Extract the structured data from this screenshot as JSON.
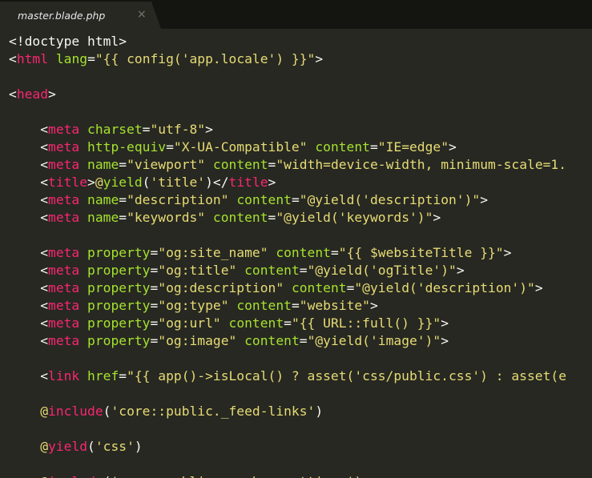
{
  "tab": {
    "title": "master.blade.php",
    "close_glyph": "×"
  },
  "theme": {
    "background": "#272822",
    "tabbar": "#141411",
    "plain": "#f8f8f2",
    "tag": "#f92672",
    "attribute": "#a6e22e",
    "string": "#e6db74"
  },
  "code": {
    "lines": [
      [
        [
          "p",
          "<!doctype html>"
        ]
      ],
      [
        [
          "p",
          "<"
        ],
        [
          "t",
          "html"
        ],
        [
          "p",
          " "
        ],
        [
          "a",
          "lang"
        ],
        [
          "p",
          "="
        ],
        [
          "s",
          "\"{{ config('app.locale') }}\""
        ],
        [
          "p",
          ">"
        ]
      ],
      [],
      [
        [
          "p",
          "<"
        ],
        [
          "t",
          "head"
        ],
        [
          "p",
          ">"
        ]
      ],
      [],
      [
        [
          "p",
          "    <"
        ],
        [
          "t",
          "meta"
        ],
        [
          "p",
          " "
        ],
        [
          "a",
          "charset"
        ],
        [
          "p",
          "="
        ],
        [
          "s",
          "\"utf-8\""
        ],
        [
          "p",
          ">"
        ]
      ],
      [
        [
          "p",
          "    <"
        ],
        [
          "t",
          "meta"
        ],
        [
          "p",
          " "
        ],
        [
          "a",
          "http-equiv"
        ],
        [
          "p",
          "="
        ],
        [
          "s",
          "\"X-UA-Compatible\""
        ],
        [
          "p",
          " "
        ],
        [
          "a",
          "content"
        ],
        [
          "p",
          "="
        ],
        [
          "s",
          "\"IE=edge\""
        ],
        [
          "p",
          ">"
        ]
      ],
      [
        [
          "p",
          "    <"
        ],
        [
          "t",
          "meta"
        ],
        [
          "p",
          " "
        ],
        [
          "a",
          "name"
        ],
        [
          "p",
          "="
        ],
        [
          "s",
          "\"viewport\""
        ],
        [
          "p",
          " "
        ],
        [
          "a",
          "content"
        ],
        [
          "p",
          "="
        ],
        [
          "s",
          "\"width=device-width, minimum-scale=1."
        ]
      ],
      [
        [
          "p",
          "    <"
        ],
        [
          "t",
          "title"
        ],
        [
          "p",
          ">"
        ],
        [
          "s",
          "@"
        ],
        [
          "a",
          "yield"
        ],
        [
          "p",
          "("
        ],
        [
          "s",
          "'title'"
        ],
        [
          "p",
          ")</"
        ],
        [
          "t",
          "title"
        ],
        [
          "p",
          ">"
        ]
      ],
      [
        [
          "p",
          "    <"
        ],
        [
          "t",
          "meta"
        ],
        [
          "p",
          " "
        ],
        [
          "a",
          "name"
        ],
        [
          "p",
          "="
        ],
        [
          "s",
          "\"description\""
        ],
        [
          "p",
          " "
        ],
        [
          "a",
          "content"
        ],
        [
          "p",
          "="
        ],
        [
          "s",
          "\"@yield('description')\""
        ],
        [
          "p",
          ">"
        ]
      ],
      [
        [
          "p",
          "    <"
        ],
        [
          "t",
          "meta"
        ],
        [
          "p",
          " "
        ],
        [
          "a",
          "name"
        ],
        [
          "p",
          "="
        ],
        [
          "s",
          "\"keywords\""
        ],
        [
          "p",
          " "
        ],
        [
          "a",
          "content"
        ],
        [
          "p",
          "="
        ],
        [
          "s",
          "\"@yield('keywords')\""
        ],
        [
          "p",
          ">"
        ]
      ],
      [],
      [
        [
          "p",
          "    <"
        ],
        [
          "t",
          "meta"
        ],
        [
          "p",
          " "
        ],
        [
          "a",
          "property"
        ],
        [
          "p",
          "="
        ],
        [
          "s",
          "\"og:site_name\""
        ],
        [
          "p",
          " "
        ],
        [
          "a",
          "content"
        ],
        [
          "p",
          "="
        ],
        [
          "s",
          "\"{{ $websiteTitle }}\""
        ],
        [
          "p",
          ">"
        ]
      ],
      [
        [
          "p",
          "    <"
        ],
        [
          "t",
          "meta"
        ],
        [
          "p",
          " "
        ],
        [
          "a",
          "property"
        ],
        [
          "p",
          "="
        ],
        [
          "s",
          "\"og:title\""
        ],
        [
          "p",
          " "
        ],
        [
          "a",
          "content"
        ],
        [
          "p",
          "="
        ],
        [
          "s",
          "\"@yield('ogTitle')\""
        ],
        [
          "p",
          ">"
        ]
      ],
      [
        [
          "p",
          "    <"
        ],
        [
          "t",
          "meta"
        ],
        [
          "p",
          " "
        ],
        [
          "a",
          "property"
        ],
        [
          "p",
          "="
        ],
        [
          "s",
          "\"og:description\""
        ],
        [
          "p",
          " "
        ],
        [
          "a",
          "content"
        ],
        [
          "p",
          "="
        ],
        [
          "s",
          "\"@yield('description')\""
        ],
        [
          "p",
          ">"
        ]
      ],
      [
        [
          "p",
          "    <"
        ],
        [
          "t",
          "meta"
        ],
        [
          "p",
          " "
        ],
        [
          "a",
          "property"
        ],
        [
          "p",
          "="
        ],
        [
          "s",
          "\"og:type\""
        ],
        [
          "p",
          " "
        ],
        [
          "a",
          "content"
        ],
        [
          "p",
          "="
        ],
        [
          "s",
          "\"website\""
        ],
        [
          "p",
          ">"
        ]
      ],
      [
        [
          "p",
          "    <"
        ],
        [
          "t",
          "meta"
        ],
        [
          "p",
          " "
        ],
        [
          "a",
          "property"
        ],
        [
          "p",
          "="
        ],
        [
          "s",
          "\"og:url\""
        ],
        [
          "p",
          " "
        ],
        [
          "a",
          "content"
        ],
        [
          "p",
          "="
        ],
        [
          "s",
          "\"{{ URL::full() }}\""
        ],
        [
          "p",
          ">"
        ]
      ],
      [
        [
          "p",
          "    <"
        ],
        [
          "t",
          "meta"
        ],
        [
          "p",
          " "
        ],
        [
          "a",
          "property"
        ],
        [
          "p",
          "="
        ],
        [
          "s",
          "\"og:image\""
        ],
        [
          "p",
          " "
        ],
        [
          "a",
          "content"
        ],
        [
          "p",
          "="
        ],
        [
          "s",
          "\"@yield('image')\""
        ],
        [
          "p",
          ">"
        ]
      ],
      [],
      [
        [
          "p",
          "    <"
        ],
        [
          "t",
          "link"
        ],
        [
          "p",
          " "
        ],
        [
          "a",
          "href"
        ],
        [
          "p",
          "="
        ],
        [
          "s",
          "\"{{ app()->isLocal() ? asset('css/public.css') : asset(e"
        ]
      ],
      [],
      [
        [
          "p",
          "    "
        ],
        [
          "s",
          "@"
        ],
        [
          "k",
          "include"
        ],
        [
          "p",
          "("
        ],
        [
          "s",
          "'core::public._feed-links'"
        ],
        [
          "p",
          ")"
        ]
      ],
      [],
      [
        [
          "p",
          "    "
        ],
        [
          "s",
          "@"
        ],
        [
          "k",
          "yield"
        ],
        [
          "p",
          "("
        ],
        [
          "s",
          "'css'"
        ],
        [
          "p",
          ")"
        ]
      ],
      [],
      [
        [
          "p",
          "    "
        ],
        [
          "s",
          "@"
        ],
        [
          "k",
          "include"
        ],
        [
          "p",
          "("
        ],
        [
          "s",
          "'core::public._navbar-settings')"
        ]
      ]
    ]
  }
}
